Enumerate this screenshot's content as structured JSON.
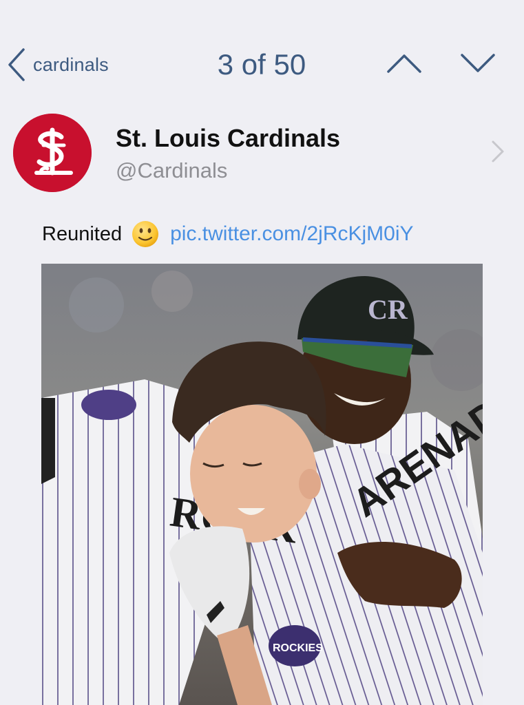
{
  "nav": {
    "back_label": "cardinals",
    "title": "3 of 50"
  },
  "profile": {
    "display_name": "St. Louis Cardinals",
    "handle": "@Cardinals",
    "brand_color": "#c8102e"
  },
  "tweet": {
    "text": "Reunited",
    "emoji": "slightly-smiling-face",
    "link": "pic.twitter.com/2jRcKjM0iY"
  },
  "media": {
    "description_icon": "photo"
  },
  "colors": {
    "nav_accent": "#3d5a80",
    "link": "#4a90e2",
    "background": "#efeff4"
  }
}
